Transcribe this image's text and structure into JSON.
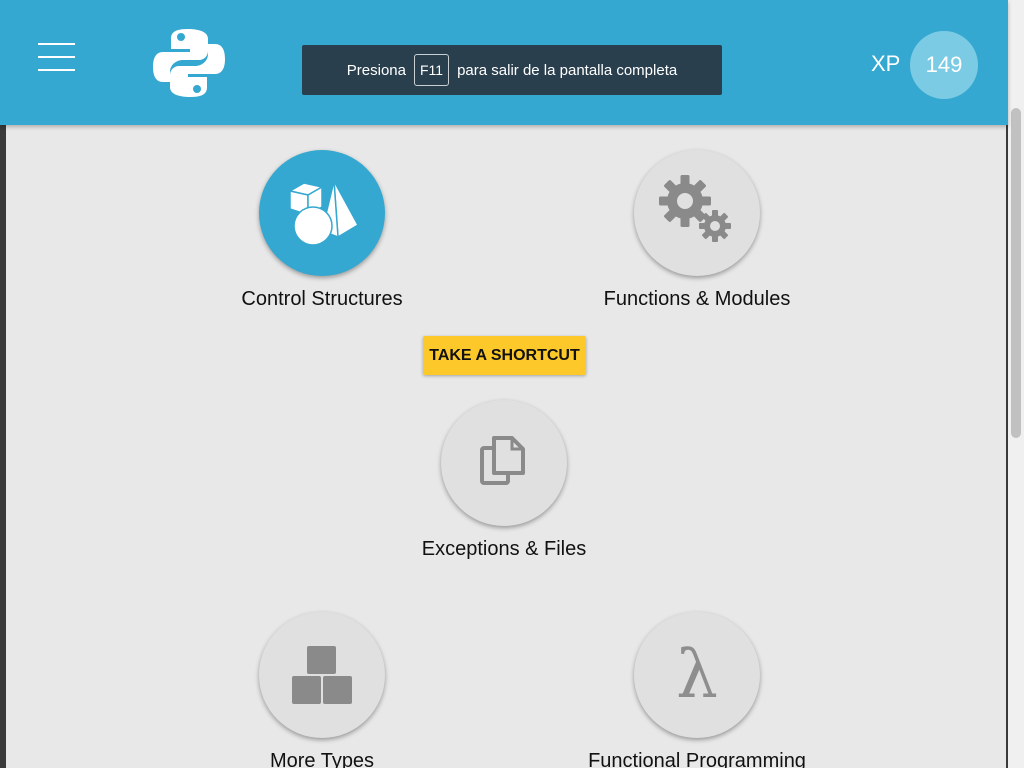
{
  "header": {
    "menu_icon": "hamburger-menu-icon",
    "logo_icon": "python-logo-icon",
    "fullscreen_notice": {
      "before": "Presiona",
      "key": "F11",
      "after": "para salir de la pantalla completa"
    },
    "xp_label": "XP",
    "xp_value": "149"
  },
  "shortcut_button": "TAKE A SHORTCUT",
  "topics": [
    {
      "label": "Control Structures",
      "icon": "shapes-icon",
      "active": true
    },
    {
      "label": "Functions & Modules",
      "icon": "gears-icon",
      "active": false
    },
    {
      "label": "Exceptions & Files",
      "icon": "files-icon",
      "active": false
    },
    {
      "label": "More Types",
      "icon": "boxes-icon",
      "active": false
    },
    {
      "label": "Functional Programming",
      "icon": "lambda-icon",
      "active": false
    }
  ],
  "colors": {
    "header": "#34a8d0",
    "active_topic": "#34a8d0",
    "shortcut_button": "#fdc92a",
    "banner": "#2a3f4d",
    "background": "#e8e8e8"
  }
}
